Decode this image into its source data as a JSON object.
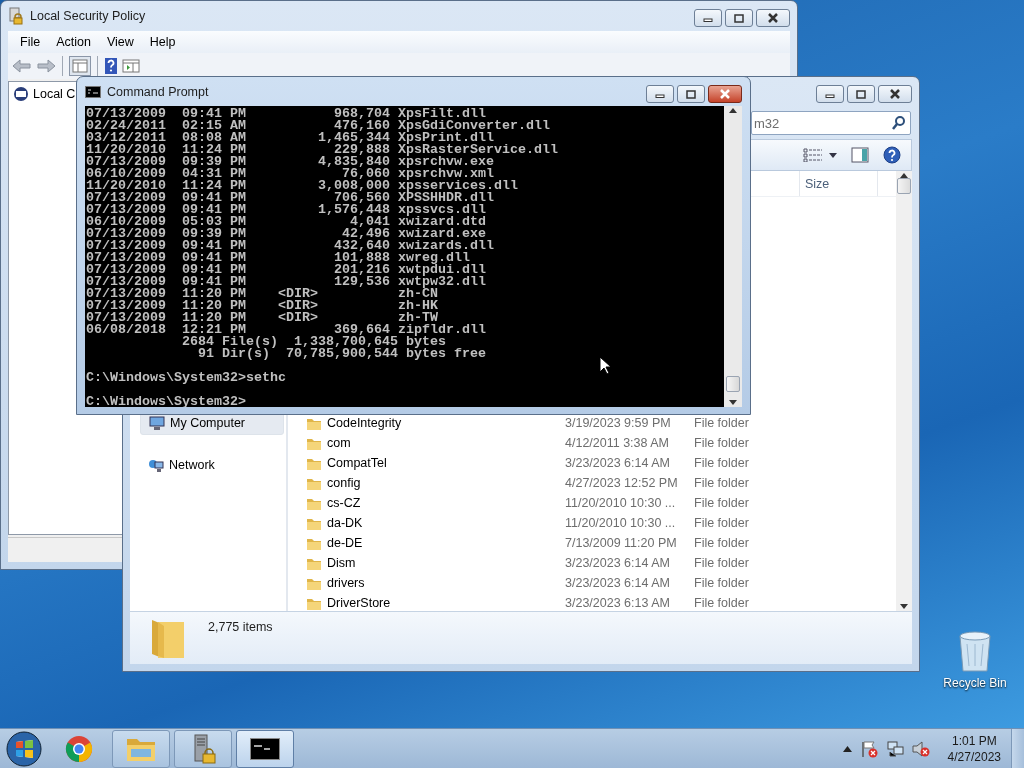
{
  "security_policy_window": {
    "title": "Local Security Policy",
    "menu": [
      "File",
      "Action",
      "View",
      "Help"
    ],
    "tree_items": [
      {
        "label": "Local C"
      }
    ]
  },
  "explorer_window": {
    "search": {
      "placeholder": "m32"
    },
    "columns": [
      "Size"
    ],
    "nav_items": [
      {
        "label": "My Computer",
        "selected": true
      },
      {
        "label": "Network",
        "selected": false
      }
    ],
    "files": [
      {
        "name": "CodeIntegrity",
        "date_modified": "3/19/2023 9:59 PM",
        "type": "File folder"
      },
      {
        "name": "com",
        "date_modified": "4/12/2011 3:38 AM",
        "type": "File folder"
      },
      {
        "name": "CompatTel",
        "date_modified": "3/23/2023 6:14 AM",
        "type": "File folder"
      },
      {
        "name": "config",
        "date_modified": "4/27/2023 12:52 PM",
        "type": "File folder"
      },
      {
        "name": "cs-CZ",
        "date_modified": "11/20/2010 10:30 ...",
        "type": "File folder"
      },
      {
        "name": "da-DK",
        "date_modified": "11/20/2010 10:30 ...",
        "type": "File folder"
      },
      {
        "name": "de-DE",
        "date_modified": "7/13/2009 11:20 PM",
        "type": "File folder"
      },
      {
        "name": "Dism",
        "date_modified": "3/23/2023 6:14 AM",
        "type": "File folder"
      },
      {
        "name": "drivers",
        "date_modified": "3/23/2023 6:14 AM",
        "type": "File folder"
      },
      {
        "name": "DriverStore",
        "date_modified": "3/23/2023 6:13 AM",
        "type": "File folder"
      }
    ],
    "status": "2,775 items"
  },
  "command_prompt": {
    "title": "Command Prompt",
    "listing": [
      {
        "kind": "file",
        "date": "07/13/2009",
        "time": "09:41 PM",
        "size": "968,704",
        "name": "XpsFilt.dll"
      },
      {
        "kind": "file",
        "date": "02/24/2011",
        "time": "02:15 AM",
        "size": "476,160",
        "name": "XpsGdiConverter.dll"
      },
      {
        "kind": "file",
        "date": "03/12/2011",
        "time": "08:08 AM",
        "size": "1,465,344",
        "name": "XpsPrint.dll"
      },
      {
        "kind": "file",
        "date": "11/20/2010",
        "time": "11:24 PM",
        "size": "229,888",
        "name": "XpsRasterService.dll"
      },
      {
        "kind": "file",
        "date": "07/13/2009",
        "time": "09:39 PM",
        "size": "4,835,840",
        "name": "xpsrchvw.exe"
      },
      {
        "kind": "file",
        "date": "06/10/2009",
        "time": "04:31 PM",
        "size": "76,060",
        "name": "xpsrchvw.xml"
      },
      {
        "kind": "file",
        "date": "11/20/2010",
        "time": "11:24 PM",
        "size": "3,008,000",
        "name": "xpsservices.dll"
      },
      {
        "kind": "file",
        "date": "07/13/2009",
        "time": "09:41 PM",
        "size": "706,560",
        "name": "XPSSHHDR.dll"
      },
      {
        "kind": "file",
        "date": "07/13/2009",
        "time": "09:41 PM",
        "size": "1,576,448",
        "name": "xpssvcs.dll"
      },
      {
        "kind": "file",
        "date": "06/10/2009",
        "time": "05:03 PM",
        "size": "4,041",
        "name": "xwizard.dtd"
      },
      {
        "kind": "file",
        "date": "07/13/2009",
        "time": "09:39 PM",
        "size": "42,496",
        "name": "xwizard.exe"
      },
      {
        "kind": "file",
        "date": "07/13/2009",
        "time": "09:41 PM",
        "size": "432,640",
        "name": "xwizards.dll"
      },
      {
        "kind": "file",
        "date": "07/13/2009",
        "time": "09:41 PM",
        "size": "101,888",
        "name": "xwreg.dll"
      },
      {
        "kind": "file",
        "date": "07/13/2009",
        "time": "09:41 PM",
        "size": "201,216",
        "name": "xwtpdui.dll"
      },
      {
        "kind": "file",
        "date": "07/13/2009",
        "time": "09:41 PM",
        "size": "129,536",
        "name": "xwtpw32.dll"
      },
      {
        "kind": "dir",
        "date": "07/13/2009",
        "time": "11:20 PM",
        "size": "<DIR>",
        "name": "zh-CN"
      },
      {
        "kind": "dir",
        "date": "07/13/2009",
        "time": "11:20 PM",
        "size": "<DIR>",
        "name": "zh-HK"
      },
      {
        "kind": "dir",
        "date": "07/13/2009",
        "time": "11:20 PM",
        "size": "<DIR>",
        "name": "zh-TW"
      },
      {
        "kind": "file",
        "date": "06/08/2018",
        "time": "12:21 PM",
        "size": "369,664",
        "name": "zipfldr.dll"
      }
    ],
    "summary": [
      "            2684 File(s)  1,338,700,645 bytes",
      "              91 Dir(s)  70,785,900,544 bytes free"
    ],
    "prompts": [
      "C:\\Windows\\System32>sethc",
      "C:\\Windows\\System32>"
    ]
  },
  "desktop": {
    "icons": [
      {
        "label": "Recycle Bin"
      }
    ]
  },
  "taskbar": {
    "items": [
      {
        "kind": "browser",
        "running": false,
        "selected": false
      },
      {
        "kind": "explorer",
        "running": true,
        "selected": false
      },
      {
        "kind": "security",
        "running": true,
        "selected": false
      },
      {
        "kind": "console",
        "running": true,
        "selected": true
      }
    ],
    "clock": {
      "time": "1:01 PM",
      "date": "4/27/2023"
    }
  }
}
